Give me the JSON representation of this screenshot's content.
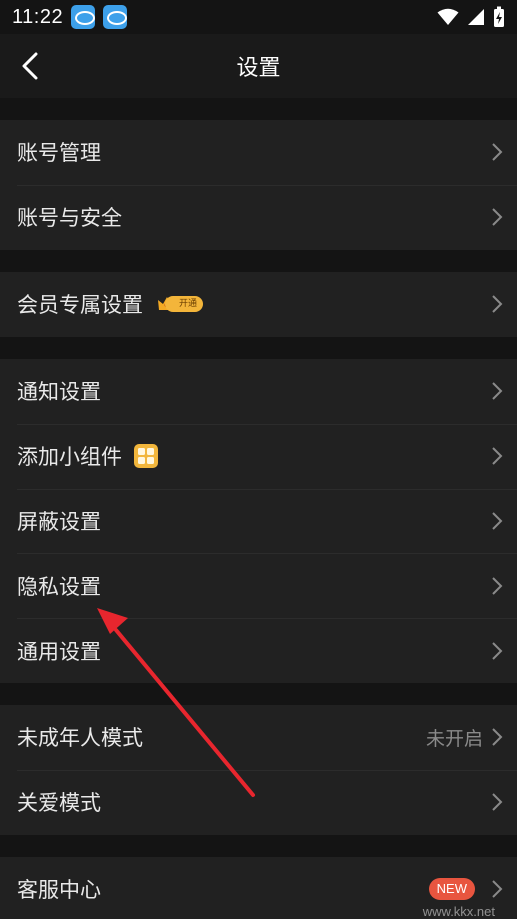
{
  "status_bar": {
    "time": "11:22",
    "icons": [
      "app-notification-icon",
      "app-notification-icon",
      "wifi-icon",
      "signal-icon",
      "battery-charging-icon"
    ]
  },
  "header": {
    "title": "设置",
    "back_icon": "chevron-left-icon"
  },
  "groups": [
    {
      "items": [
        {
          "label": "账号管理"
        },
        {
          "label": "账号与安全"
        }
      ]
    },
    {
      "items": [
        {
          "label": "会员专属设置",
          "badge": "开通",
          "badge_icon": "crown-icon"
        }
      ]
    },
    {
      "items": [
        {
          "label": "通知设置"
        },
        {
          "label": "添加小组件",
          "badge_icon": "widget-grid-icon"
        },
        {
          "label": "屏蔽设置"
        },
        {
          "label": "隐私设置"
        },
        {
          "label": "通用设置"
        }
      ]
    },
    {
      "items": [
        {
          "label": "未成年人模式",
          "value": "未开启"
        },
        {
          "label": "关爱模式"
        }
      ]
    },
    {
      "items": [
        {
          "label": "客服中心",
          "badge": "NEW"
        }
      ]
    }
  ],
  "annotation": {
    "type": "red-arrow",
    "target": "隐私设置",
    "color": "#e8262e"
  },
  "watermark": "www.kkx.net",
  "colors": {
    "background": "#141414",
    "row_background": "#212121",
    "text": "#e9e9e9",
    "secondary_text": "#8a8a8a",
    "badge_new": "#e8553f",
    "badge_vip": "#f3b53a"
  }
}
